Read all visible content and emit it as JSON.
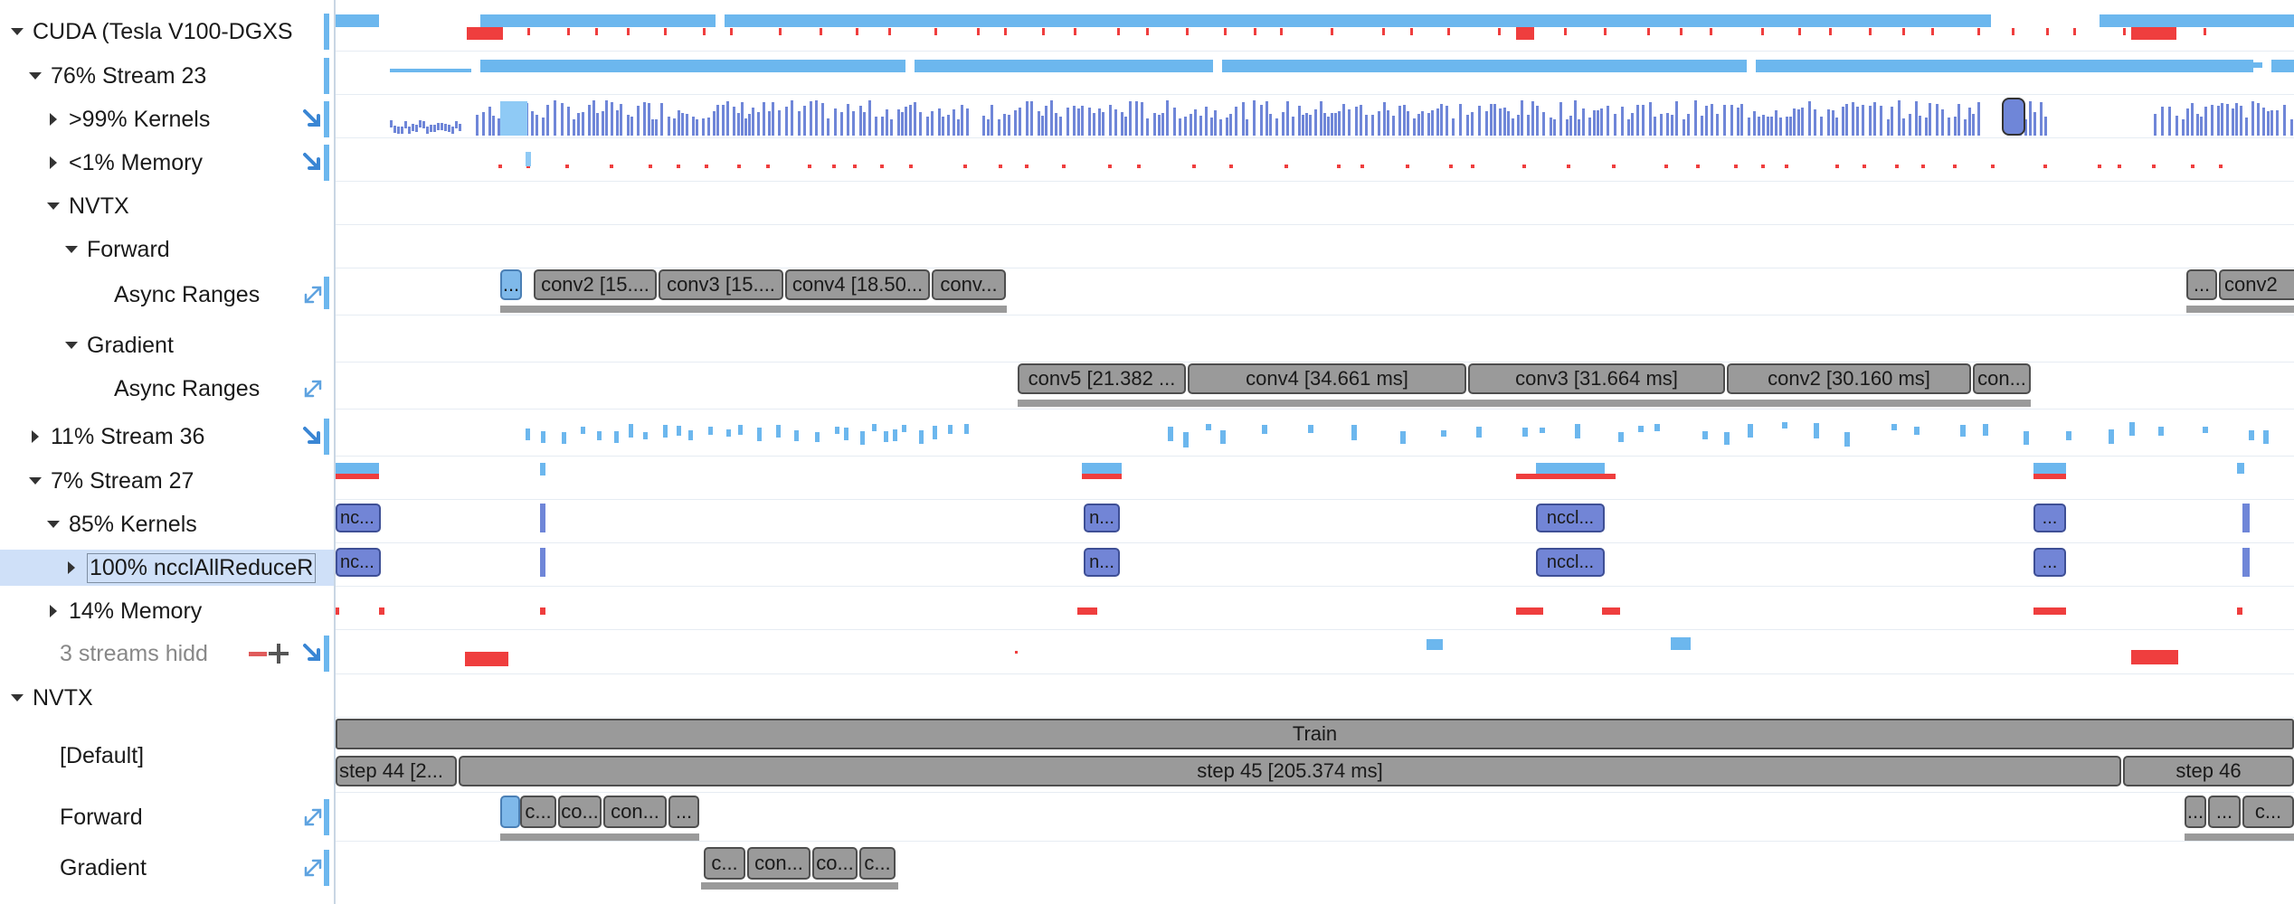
{
  "tree": {
    "rows": [
      {
        "label": "CUDA (Tesla V100-DGXS",
        "caret": "down",
        "indent": 12
      },
      {
        "label": "76% Stream 23",
        "caret": "down",
        "indent": 32
      },
      {
        "label": ">99% Kernels",
        "caret": "right",
        "indent": 52,
        "icon": "arrow-down-right-icon"
      },
      {
        "label": "<1% Memory",
        "caret": "right",
        "indent": 52,
        "icon": "arrow-down-right-icon"
      },
      {
        "label": "NVTX",
        "caret": "down",
        "indent": 52
      },
      {
        "label": "Forward",
        "caret": "down",
        "indent": 72
      },
      {
        "label": "Async Ranges",
        "caret": "none",
        "indent": 126,
        "icon": "expand-diagonal-icon"
      },
      {
        "label": "Gradient",
        "caret": "down",
        "indent": 72
      },
      {
        "label": "Async Ranges",
        "caret": "none",
        "indent": 126,
        "icon": "expand-diagonal-icon"
      },
      {
        "label": "11% Stream 36",
        "caret": "right",
        "indent": 32,
        "icon": "arrow-down-right-icon"
      },
      {
        "label": "7% Stream 27",
        "caret": "down",
        "indent": 32
      },
      {
        "label": "85% Kernels",
        "caret": "down",
        "indent": 52
      },
      {
        "label": "100% ncclAllReduceR",
        "caret": "right",
        "indent": 72
      },
      {
        "label": "14% Memory",
        "caret": "right",
        "indent": 52
      },
      {
        "label": "3 streams hidd",
        "caret": "none",
        "indent": 66,
        "icon": "arrow-down-right-icon"
      },
      {
        "label": "NVTX",
        "caret": "down",
        "indent": 12
      },
      {
        "label": "[Default]",
        "caret": "none",
        "indent": 66
      },
      {
        "label": "Forward",
        "caret": "none",
        "indent": 66,
        "icon": "expand-diagonal-icon"
      },
      {
        "label": "Gradient",
        "caret": "none",
        "indent": 66,
        "icon": "expand-diagonal-icon"
      }
    ]
  },
  "forward_ranges": [
    "...",
    "conv2 [15....",
    "conv3 [15....",
    "conv4 [18.50...",
    "conv..."
  ],
  "forward_right": [
    "...",
    "conv2"
  ],
  "gradient_ranges": [
    "conv5 [21.382 ...",
    "conv4 [34.661 ms]",
    "conv3 [31.664 ms]",
    "conv2 [30.160 ms]",
    "con..."
  ],
  "nccl_labels": [
    "nc...",
    "n...",
    "nccl...",
    "..."
  ],
  "nvtx": {
    "train": "Train",
    "steps": [
      "step 44 [2...",
      "step 45 [205.374 ms]",
      "step 46"
    ],
    "forward_small": [
      "c...",
      "co...",
      "con...",
      "..."
    ],
    "forward_right": [
      "...",
      "...",
      "c..."
    ],
    "gradient_small": [
      "c...",
      "con...",
      "co...",
      "c..."
    ]
  },
  "colors": {
    "kernel": "#6f86d8",
    "memcpy": "#6cb7ee",
    "memset": "#ef3e3e",
    "range": "#9a9a9a",
    "selection": "#cfe0f8"
  }
}
